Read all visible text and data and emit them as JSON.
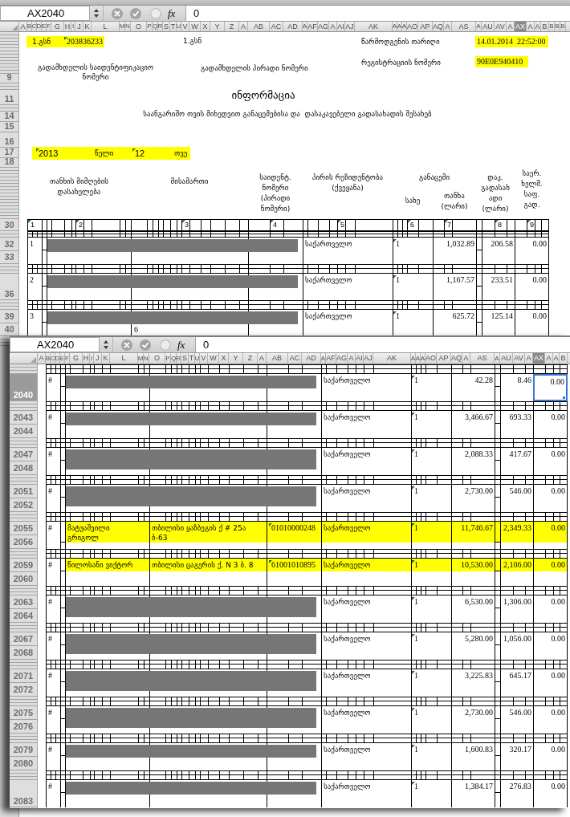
{
  "back_window": {
    "name_box": "AX2040",
    "formula_bar": {
      "function_label": "fx",
      "value": "0"
    },
    "columns": [
      {
        "label": "A",
        "selected": false
      },
      {
        "label": "B",
        "selected": false
      },
      {
        "label": "C",
        "selected": false
      },
      {
        "label": "D",
        "selected": false
      },
      {
        "label": "E",
        "selected": false
      },
      {
        "label": "F",
        "selected": false
      },
      {
        "label": "G",
        "selected": false
      },
      {
        "label": "H",
        "selected": false
      },
      {
        "label": "I",
        "selected": false
      },
      {
        "label": "J",
        "selected": false
      },
      {
        "label": "K",
        "selected": false
      },
      {
        "label": "L",
        "selected": false
      },
      {
        "label": "M",
        "selected": false
      },
      {
        "label": "N",
        "selected": false
      },
      {
        "label": "O",
        "selected": false
      },
      {
        "label": "P",
        "selected": false
      },
      {
        "label": "Q",
        "selected": false
      },
      {
        "label": "R",
        "selected": false
      },
      {
        "label": "S",
        "selected": false
      },
      {
        "label": "T",
        "selected": false
      },
      {
        "label": "U",
        "selected": false
      },
      {
        "label": "V",
        "selected": false
      },
      {
        "label": "W",
        "selected": false
      },
      {
        "label": "X",
        "selected": false
      },
      {
        "label": "Y",
        "selected": false
      },
      {
        "label": "Z",
        "selected": false
      },
      {
        "label": "A",
        "selected": false
      },
      {
        "label": "AB",
        "selected": false
      },
      {
        "label": "AC",
        "selected": false
      },
      {
        "label": "AD",
        "selected": false
      },
      {
        "label": "A",
        "selected": false
      },
      {
        "label": "AF",
        "selected": false
      },
      {
        "label": "AG",
        "selected": false
      },
      {
        "label": "A",
        "selected": false
      },
      {
        "label": "AI",
        "selected": false
      },
      {
        "label": "AJ",
        "selected": false
      },
      {
        "label": "AK",
        "selected": false
      },
      {
        "label": "A",
        "selected": false
      },
      {
        "label": "A",
        "selected": false
      },
      {
        "label": "A",
        "selected": false
      },
      {
        "label": "AO",
        "selected": false
      },
      {
        "label": "AP",
        "selected": false
      },
      {
        "label": "AQ",
        "selected": false
      },
      {
        "label": "A",
        "selected": false
      },
      {
        "label": "AS",
        "selected": false
      },
      {
        "label": "A",
        "selected": false
      },
      {
        "label": "AU",
        "selected": false
      },
      {
        "label": "AV",
        "selected": false
      },
      {
        "label": "A",
        "selected": false
      },
      {
        "label": "AX",
        "selected": true
      },
      {
        "label": "A",
        "selected": false
      },
      {
        "label": "A",
        "selected": false
      },
      {
        "label": "B",
        "selected": false
      },
      {
        "label": "B",
        "selected": false
      },
      {
        "label": "B",
        "selected": false
      },
      {
        "label": "B",
        "selected": false
      }
    ],
    "form_row_labels": [
      "9",
      "11",
      "14",
      "15",
      "16",
      "17",
      "18"
    ],
    "header": {
      "taxpayer_id": {
        "label": "1.გსნ",
        "value": "203836233",
        "flagged": true,
        "highlighted": true
      },
      "personal_id": {
        "label": "1.გსნ",
        "highlighted": false
      },
      "submission_date": {
        "label": "წარმოდგენის თარიღი",
        "value": "14.01.2014  22:52:00",
        "highlighted": true
      },
      "taxpayer_id_caption": [
        "გადამხდელის საიდენტიფიკაციო",
        "ნომერი"
      ],
      "personal_id_caption": "გადამხდელის პირადი ნომერი",
      "registration_number": {
        "label": "რეგისტრაციის ნომერი",
        "value": "90E0E940410",
        "highlighted": true
      },
      "title": "ინფორმაცია",
      "subtitle": "საანგარიშო თვის მიხედვით განაცემებისა და  დასაკავებელი გადასახადის შესახებ",
      "period": {
        "year": {
          "text": "2013",
          "flagged": true
        },
        "year_label": "წელი",
        "month": {
          "text": "12",
          "flagged": true
        },
        "month_label": "თვე",
        "highlighted": true
      },
      "table_headings": {
        "recipient": [
          "თანხის მიმღების",
          "დასახელება"
        ],
        "address": [
          "მისამართი"
        ],
        "id_number": [
          "საიდენტ.",
          "ნომერი",
          "(პირადი",
          "ნომერი)"
        ],
        "residency": [
          "პირის რეზიდენტობა",
          "(ქვეყანა)"
        ],
        "payout": [
          "განაცემი"
        ],
        "payout_type": [
          "სახე"
        ],
        "payout_amount": [
          "თანხა",
          "(ლარი)"
        ],
        "withheld_tax": [
          "დაკ.",
          "გადასახ",
          "ადი",
          "(ლარი)"
        ],
        "treaty_tax": [
          "საერ.",
          "ხელშ.",
          "საფ.",
          "გად."
        ]
      }
    },
    "numbers_row_label": "30",
    "column_numbers": [
      {
        "text": "1",
        "flagged": true
      },
      {
        "text": "2",
        "flagged": true
      },
      {
        "text": "3",
        "flagged": true
      },
      {
        "text": "4",
        "flagged": true
      },
      {
        "text": "5",
        "flagged": true
      },
      {
        "text": "6",
        "flagged": true
      },
      {
        "text": "7",
        "flagged": true
      },
      {
        "text": "8",
        "flagged": true
      },
      {
        "text": "9",
        "flagged": true
      }
    ],
    "rows": [
      {
        "row_header": {
          "labels": [
            "32",
            "33"
          ],
          "selected": false
        },
        "kind": "shortbar",
        "number": "1",
        "country": "საქართველო",
        "type": {
          "text": "1",
          "flagged": true
        },
        "amount": "1,032.89",
        "withheld_tax": "206.58",
        "treaty_tax": {
          "text": "0.00",
          "selected": false
        },
        "highlighted": false
      },
      {
        "row_header": {
          "labels": [
            "36"
          ],
          "selected": false
        },
        "kind": "shortbar",
        "number": "2",
        "country": "საქართველო",
        "type": {
          "text": "1",
          "flagged": true
        },
        "amount": "1,167.57",
        "withheld_tax": "233.51",
        "treaty_tax": {
          "text": "0.00",
          "selected": false
        },
        "highlighted": false
      },
      {
        "row_header": {
          "labels": [
            "39",
            "40"
          ],
          "selected": false
        },
        "kind": "shortbar",
        "number": "3",
        "address": "6",
        "country": "საქართველო",
        "type": {
          "text": "1",
          "flagged": true
        },
        "amount": "625.72",
        "withheld_tax": "125.14",
        "treaty_tax": {
          "text": "0.00",
          "selected": false
        },
        "highlighted": false
      }
    ]
  },
  "front_window": {
    "name_box": "AX2040",
    "formula_bar": {
      "function_label": "fx",
      "value": "0"
    },
    "columns": [
      {
        "label": "A",
        "selected": false
      },
      {
        "label": "B",
        "selected": false
      },
      {
        "label": "C",
        "selected": false
      },
      {
        "label": "D",
        "selected": false
      },
      {
        "label": "E",
        "selected": false
      },
      {
        "label": "F",
        "selected": false
      },
      {
        "label": "G",
        "selected": false
      },
      {
        "label": "H",
        "selected": false
      },
      {
        "label": "I",
        "selected": false
      },
      {
        "label": "J",
        "selected": false
      },
      {
        "label": "K",
        "selected": false
      },
      {
        "label": "L",
        "selected": false
      },
      {
        "label": "M",
        "selected": false
      },
      {
        "label": "N",
        "selected": false
      },
      {
        "label": "O",
        "selected": false
      },
      {
        "label": "P",
        "selected": false
      },
      {
        "label": "Q",
        "selected": false
      },
      {
        "label": "R",
        "selected": false
      },
      {
        "label": "S",
        "selected": false
      },
      {
        "label": "T",
        "selected": false
      },
      {
        "label": "U",
        "selected": false
      },
      {
        "label": "V",
        "selected": false
      },
      {
        "label": "W",
        "selected": false
      },
      {
        "label": "X",
        "selected": false
      },
      {
        "label": "Y",
        "selected": false
      },
      {
        "label": "Z",
        "selected": false
      },
      {
        "label": "A",
        "selected": false
      },
      {
        "label": "AB",
        "selected": false
      },
      {
        "label": "AC",
        "selected": false
      },
      {
        "label": "AD",
        "selected": false
      },
      {
        "label": "A",
        "selected": false
      },
      {
        "label": "AF",
        "selected": false
      },
      {
        "label": "AG",
        "selected": false
      },
      {
        "label": "A",
        "selected": false
      },
      {
        "label": "AI",
        "selected": false
      },
      {
        "label": "AJ",
        "selected": false
      },
      {
        "label": "AK",
        "selected": false
      },
      {
        "label": "A",
        "selected": false
      },
      {
        "label": "A",
        "selected": false
      },
      {
        "label": "A",
        "selected": false
      },
      {
        "label": "AO",
        "selected": false
      },
      {
        "label": "AP",
        "selected": false
      },
      {
        "label": "AQ",
        "selected": false
      },
      {
        "label": "A",
        "selected": false
      },
      {
        "label": "AS",
        "selected": false
      },
      {
        "label": "A",
        "selected": false
      },
      {
        "label": "AU",
        "selected": false
      },
      {
        "label": "AV",
        "selected": false
      },
      {
        "label": "A",
        "selected": false
      },
      {
        "label": "AX",
        "selected": true
      },
      {
        "label": "A",
        "selected": false
      },
      {
        "label": "A",
        "selected": false
      },
      {
        "label": "B",
        "selected": false
      }
    ],
    "rows": [
      {
        "row_header": {
          "labels": [
            "2040"
          ],
          "selected": true
        },
        "kind": "shortbar",
        "number": "#",
        "country": "საქართველო",
        "type": {
          "text": "1",
          "flagged": true
        },
        "amount": "42.28",
        "withheld_tax": "8.46",
        "treaty_tax": {
          "text": "0.00",
          "selected": true
        },
        "highlighted": false
      },
      {
        "row_header": {
          "labels": [
            "2043",
            "2044"
          ],
          "selected": false
        },
        "kind": "shortbar",
        "number": "#",
        "country": "საქართველო",
        "type": {
          "text": "1",
          "flagged": true
        },
        "amount": "3,466.67",
        "withheld_tax": "693.33",
        "treaty_tax": {
          "text": "0.00",
          "selected": false
        },
        "highlighted": false
      },
      {
        "row_header": {
          "labels": [
            "2047",
            "2048"
          ],
          "selected": false
        },
        "kind": "tallbar",
        "number": "#",
        "country": "საქართველო",
        "type": {
          "text": "1",
          "flagged": true
        },
        "amount": "2,088.33",
        "withheld_tax": "417.67",
        "treaty_tax": {
          "text": "0.00",
          "selected": false
        },
        "highlighted": false
      },
      {
        "row_header": {
          "labels": [
            "2051",
            "2052"
          ],
          "selected": false
        },
        "kind": "tallbar",
        "number": "#",
        "country": "საქართველო",
        "type": {
          "text": "1",
          "flagged": true
        },
        "amount": "2,730.00",
        "withheld_tax": "546.00",
        "treaty_tax": {
          "text": "0.00",
          "selected": false
        },
        "highlighted": false
      },
      {
        "row_header": {
          "labels": [
            "2055",
            "2056"
          ],
          "selected": false
        },
        "kind": "plain",
        "number": "#",
        "name": "მატუაშვილი გრიგოლ",
        "address": "თბილისი ყაზბეგის ქ # 25ა ბ-63",
        "id": {
          "text": "01010000248",
          "flagged": true
        },
        "country": "საქართველო",
        "type": {
          "text": "1",
          "flagged": true
        },
        "amount": "11,746.67",
        "withheld_tax": "2,349.33",
        "treaty_tax": {
          "text": "0.00",
          "selected": false
        },
        "highlighted": true
      },
      {
        "row_header": {
          "labels": [
            "2059",
            "2060"
          ],
          "selected": false
        },
        "kind": "plain",
        "number": "#",
        "name": "წილოსანი ვიქტორ",
        "address": "თბილისი ცაგერის ქ. N 3 ბ. 8",
        "id": {
          "text": "61001010895",
          "flagged": true
        },
        "country": "საქართველო",
        "type": {
          "text": "1",
          "flagged": true
        },
        "amount": "10,530.00",
        "withheld_tax": "2,106.00",
        "treaty_tax": {
          "text": "0.00",
          "selected": false
        },
        "highlighted": true
      },
      {
        "row_header": {
          "labels": [
            "2063",
            "2064"
          ],
          "selected": false
        },
        "kind": "tallbar",
        "number": "#",
        "country": "საქართველო",
        "type": {
          "text": "1",
          "flagged": true
        },
        "amount": "6,530.00",
        "withheld_tax": "1,306.00",
        "treaty_tax": {
          "text": "0.00",
          "selected": false
        },
        "highlighted": false
      },
      {
        "row_header": {
          "labels": [
            "2067",
            "2068"
          ],
          "selected": false
        },
        "kind": "tallbar",
        "number": "#",
        "country": "საქართველო",
        "type": {
          "text": "1",
          "flagged": true
        },
        "amount": "5,280.00",
        "withheld_tax": "1,056.00",
        "treaty_tax": {
          "text": "0.00",
          "selected": false
        },
        "highlighted": false
      },
      {
        "row_header": {
          "labels": [
            "2071",
            "2072"
          ],
          "selected": false
        },
        "kind": "tallbar",
        "number": "#",
        "country": "საქართველო",
        "type": {
          "text": "1",
          "flagged": true
        },
        "amount": "3,225.83",
        "withheld_tax": "645.17",
        "treaty_tax": {
          "text": "0.00",
          "selected": false
        },
        "highlighted": false
      },
      {
        "row_header": {
          "labels": [
            "2075",
            "2076"
          ],
          "selected": false
        },
        "kind": "tallbar",
        "number": "#",
        "country": "საქართველო",
        "type": {
          "text": "1",
          "flagged": true
        },
        "amount": "2,730.00",
        "withheld_tax": "546.00",
        "treaty_tax": {
          "text": "0.00",
          "selected": false
        },
        "highlighted": false
      },
      {
        "row_header": {
          "labels": [
            "2079",
            "2080"
          ],
          "selected": false
        },
        "kind": "shortbar",
        "number": "#",
        "country": "საქართველო",
        "type": {
          "text": "1",
          "flagged": true
        },
        "amount": "1,600.83",
        "withheld_tax": "320.17",
        "treaty_tax": {
          "text": "0.00",
          "selected": false
        },
        "highlighted": false
      },
      {
        "row_header": {
          "labels": [
            "2083"
          ],
          "selected": false
        },
        "kind": "shortbar",
        "number": "#",
        "country": "საქართველო",
        "type": {
          "text": "1",
          "flagged": true
        },
        "amount": "1,384.17",
        "withheld_tax": "276.83",
        "treaty_tax": {
          "text": "0.00",
          "selected": false
        },
        "highlighted": false
      }
    ]
  }
}
